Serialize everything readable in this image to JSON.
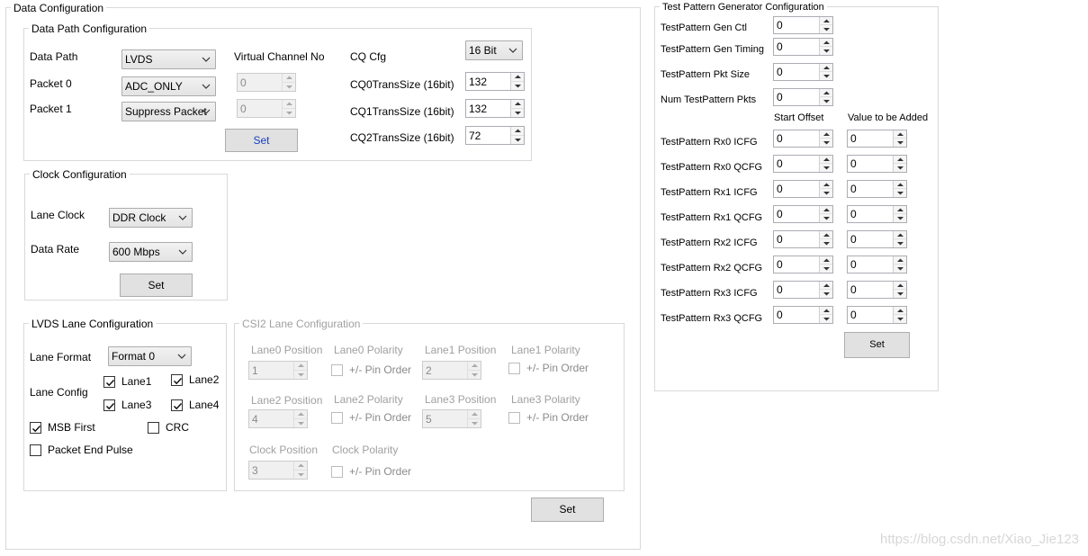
{
  "data_configuration": {
    "title": "Data Configuration",
    "set_label": "Set",
    "data_path_configuration": {
      "title": "Data Path Configuration",
      "data_path_label": "Data Path",
      "data_path_value": "LVDS",
      "packet0_label": "Packet 0",
      "packet0_value": "ADC_ONLY",
      "packet1_label": "Packet 1",
      "packet1_value": "Suppress Packet",
      "virtual_channel_label": "Virtual Channel No",
      "vc0_value": "0",
      "vc1_value": "0",
      "set_label": "Set",
      "cq_cfg_label": "CQ Cfg",
      "cq_cfg_value": "16 Bit",
      "cq0_label": "CQ0TransSize (16bit)",
      "cq0_value": "132",
      "cq1_label": "CQ1TransSize (16bit)",
      "cq1_value": "132",
      "cq2_label": "CQ2TransSize (16bit)",
      "cq2_value": "72"
    },
    "clock_configuration": {
      "title": "Clock Configuration",
      "lane_clock_label": "Lane Clock",
      "lane_clock_value": "DDR Clock",
      "data_rate_label": "Data Rate",
      "data_rate_value": "600 Mbps",
      "set_label": "Set"
    },
    "lvds_lane_configuration": {
      "title": "LVDS Lane Configuration",
      "lane_format_label": "Lane Format",
      "lane_format_value": "Format 0",
      "lane_config_label": "Lane Config",
      "lane1_label": "Lane1",
      "lane2_label": "Lane2",
      "lane3_label": "Lane3",
      "lane4_label": "Lane4",
      "msb_first_label": "MSB First",
      "crc_label": "CRC",
      "packet_end_pulse_label": "Packet End Pulse"
    },
    "csi2_lane_configuration": {
      "title": "CSI2 Lane Configuration",
      "lane0_position_label": "Lane0 Position",
      "lane0_position_value": "1",
      "lane0_polarity_label": "Lane0 Polarity",
      "lane1_position_label": "Lane1 Position",
      "lane1_position_value": "2",
      "lane1_polarity_label": "Lane1 Polarity",
      "lane2_position_label": "Lane2 Position",
      "lane2_position_value": "4",
      "lane2_polarity_label": "Lane2 Polarity",
      "lane3_position_label": "Lane3 Position",
      "lane3_position_value": "5",
      "lane3_polarity_label": "Lane3 Polarity",
      "clock_position_label": "Clock Position",
      "clock_position_value": "3",
      "clock_polarity_label": "Clock Polarity",
      "pin_order_label": "+/- Pin Order"
    }
  },
  "test_pattern": {
    "title": "Test Pattern Generator Configuration",
    "gen_ctl_label": "TestPattern Gen Ctl",
    "gen_ctl_value": "0",
    "gen_timing_label": "TestPattern Gen Timing",
    "gen_timing_value": "0",
    "pkt_size_label": "TestPattern Pkt Size",
    "pkt_size_value": "0",
    "num_pkts_label": "Num TestPattern Pkts",
    "num_pkts_value": "0",
    "start_offset_header": "Start Offset",
    "value_added_header": "Value to be Added",
    "rows": [
      {
        "label": "TestPattern Rx0 ICFG",
        "start": "0",
        "add": "0"
      },
      {
        "label": "TestPattern Rx0 QCFG",
        "start": "0",
        "add": "0"
      },
      {
        "label": "TestPattern Rx1 ICFG",
        "start": "0",
        "add": "0"
      },
      {
        "label": "TestPattern Rx1 QCFG",
        "start": "0",
        "add": "0"
      },
      {
        "label": "TestPattern Rx2 ICFG",
        "start": "0",
        "add": "0"
      },
      {
        "label": "TestPattern Rx2 QCFG",
        "start": "0",
        "add": "0"
      },
      {
        "label": "TestPattern Rx3 ICFG",
        "start": "0",
        "add": "0"
      },
      {
        "label": "TestPattern Rx3 QCFG",
        "start": "0",
        "add": "0"
      }
    ],
    "set_label": "Set"
  },
  "watermark": "https://blog.csdn.net/Xiao_Jie123",
  "colors": {
    "set_link_blue": "#1a3fbf",
    "group_border": "#d9d9d9",
    "button_face": "#e1e1e1"
  }
}
